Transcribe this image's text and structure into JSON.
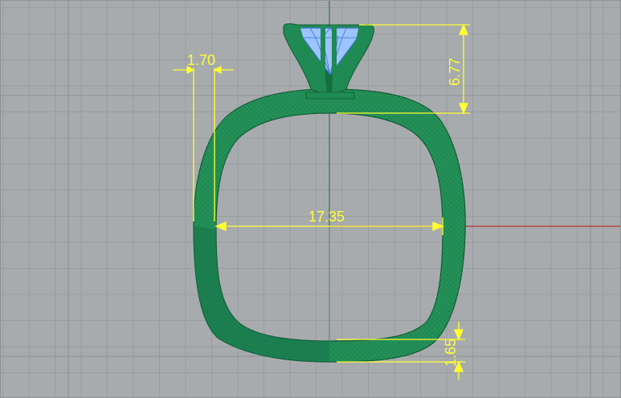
{
  "viewport": {
    "view": "Front",
    "colors": {
      "background": "#a8abae",
      "grid": "#9a9da0",
      "grid_major": "#8c8f92",
      "axis_x": "#b0352c",
      "axis_y": "#2e7d3b",
      "ring": "#1f8a53",
      "ring_shadow": "#0f5a33",
      "wire": "#3fa86e",
      "gem": "#9dc4ff",
      "gem_wire": "#3d6fd6",
      "dimension": "#ffff33"
    }
  },
  "dimensions": {
    "shank_width": "1.70",
    "inner_diameter": "17.35",
    "head_height": "6.77",
    "bottom_thickness": "1.65"
  }
}
